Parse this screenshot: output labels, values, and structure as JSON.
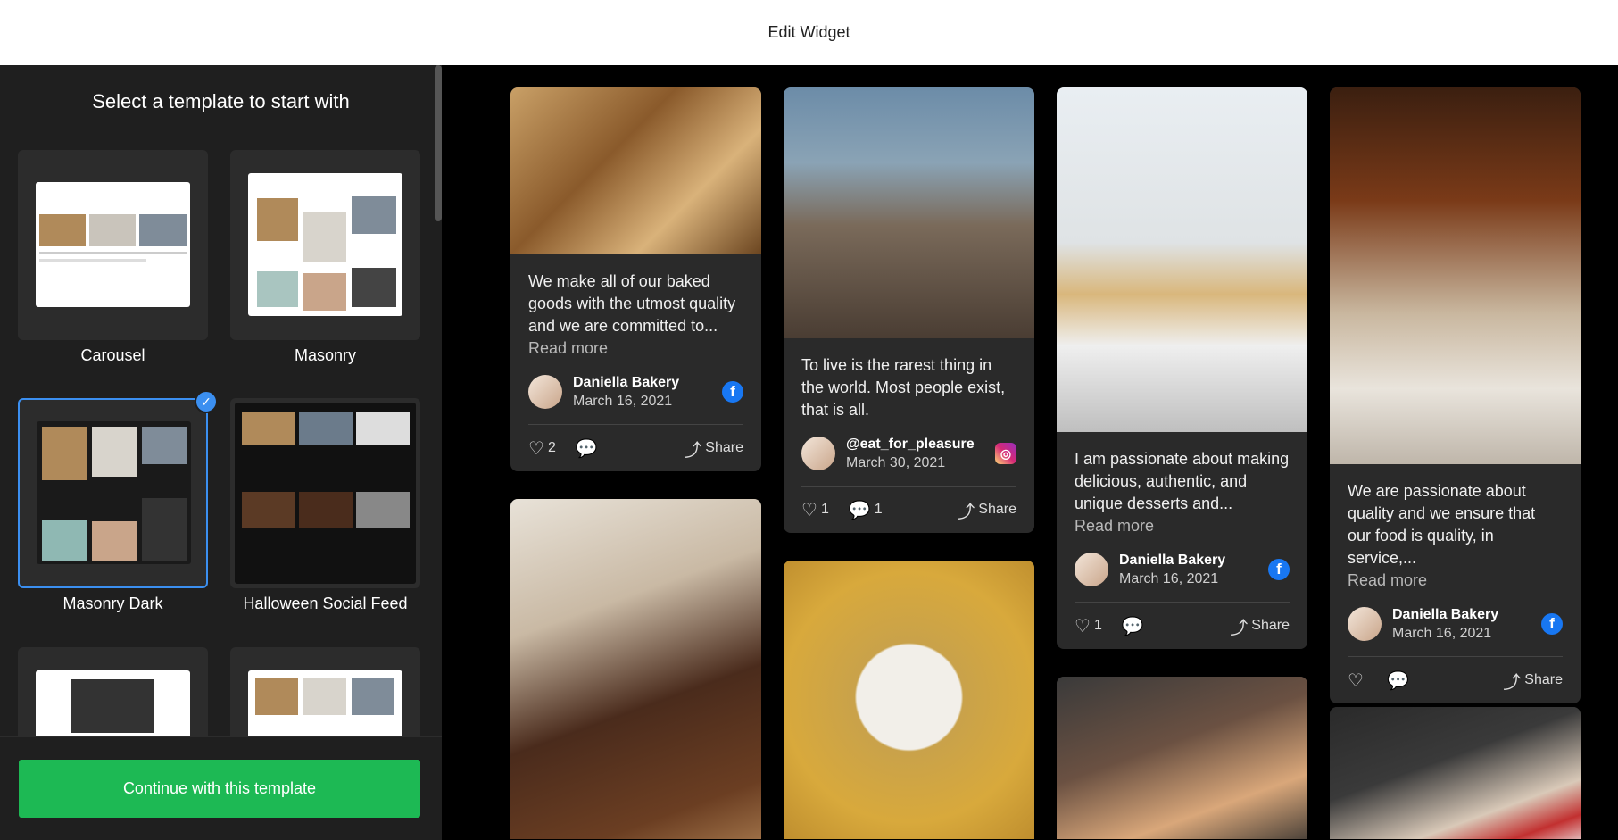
{
  "topbar": {
    "title": "Edit Widget"
  },
  "sidebar": {
    "heading": "Select a template to start with",
    "templates": [
      {
        "label": "Carousel"
      },
      {
        "label": "Masonry"
      },
      {
        "label": "Masonry Dark",
        "selected": true
      },
      {
        "label": "Halloween Social Feed"
      }
    ],
    "continue_label": "Continue with this template"
  },
  "feed": {
    "posts": [
      {
        "text": "We make all of our baked goods with the utmost quality and we are committed to...",
        "read_more": "Read more",
        "author": "Daniella Bakery",
        "date": "March 16, 2021",
        "network": "facebook",
        "likes": "2",
        "comments": "",
        "share": "Share"
      },
      {
        "text": "To live is the rarest thing in the world. Most people exist, that is all.",
        "read_more": "",
        "author": "@eat_for_pleasure",
        "date": "March 30, 2021",
        "network": "instagram",
        "likes": "1",
        "comments": "1",
        "share": "Share"
      },
      {
        "text": "I am passionate about making delicious, authentic, and unique desserts and...",
        "read_more": "Read more",
        "author": "Daniella Bakery",
        "date": "March 16, 2021",
        "network": "facebook",
        "likes": "1",
        "comments": "",
        "share": "Share"
      },
      {
        "text": "We are passionate about quality and we ensure that our food is quality, in service,...",
        "read_more": "Read more",
        "author": "Daniella Bakery",
        "date": "March 16, 2021",
        "network": "facebook",
        "likes": "",
        "comments": "",
        "share": "Share"
      }
    ]
  },
  "colors": {
    "accent": "#3b8ff0",
    "continue_button": "#1db954",
    "facebook": "#1877f2"
  }
}
